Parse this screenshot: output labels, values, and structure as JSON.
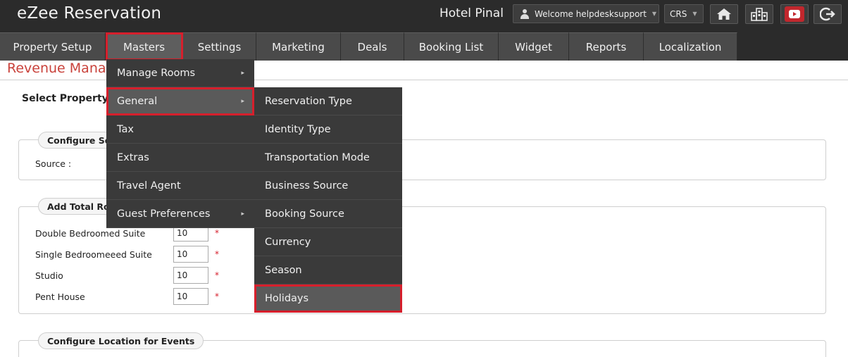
{
  "header": {
    "app_title": "eZee Reservation",
    "hotel_name": "Hotel Pinal",
    "welcome_text": "Welcome helpdesksupport",
    "crs_label": "CRS",
    "icons": [
      "home-icon",
      "building-icon",
      "youtube-icon",
      "logout-icon"
    ]
  },
  "nav": {
    "items": [
      {
        "label": "Property Setup"
      },
      {
        "label": "Masters"
      },
      {
        "label": "Settings"
      },
      {
        "label": "Marketing"
      },
      {
        "label": "Deals"
      },
      {
        "label": "Booking List"
      },
      {
        "label": "Widget"
      },
      {
        "label": "Reports"
      },
      {
        "label": "Localization"
      }
    ],
    "active": "Masters"
  },
  "masters_menu": {
    "items": [
      {
        "label": "Manage Rooms"
      },
      {
        "label": "General"
      },
      {
        "label": "Tax"
      },
      {
        "label": "Extras"
      },
      {
        "label": "Travel Agent"
      },
      {
        "label": "Guest Preferences"
      }
    ]
  },
  "general_submenu": {
    "items": [
      {
        "label": "Reservation Type"
      },
      {
        "label": "Identity Type"
      },
      {
        "label": "Transportation Mode"
      },
      {
        "label": "Business Source"
      },
      {
        "label": "Booking Source"
      },
      {
        "label": "Currency"
      },
      {
        "label": "Season"
      },
      {
        "label": "Holidays"
      }
    ]
  },
  "page": {
    "heading": "Revenue Manag",
    "select_property": "Select Property",
    "section1_title": "Configure Sou",
    "source_label": "Source :",
    "section2_title": "Add Total Roo",
    "rooms": [
      {
        "name": "Double Bedroomed Suite",
        "value": "10"
      },
      {
        "name": "Single Bedroomeeed Suite",
        "value": "10"
      },
      {
        "name": "Studio",
        "value": "10"
      },
      {
        "name": "Pent House",
        "value": "10"
      }
    ],
    "required_mark": "*",
    "section3_title": "Configure Location for Events"
  },
  "colors": {
    "header_bg": "#2b2b2b",
    "nav_bg": "#4a4a4a",
    "highlight": "#d61f2c",
    "heading": "#c9423b"
  }
}
